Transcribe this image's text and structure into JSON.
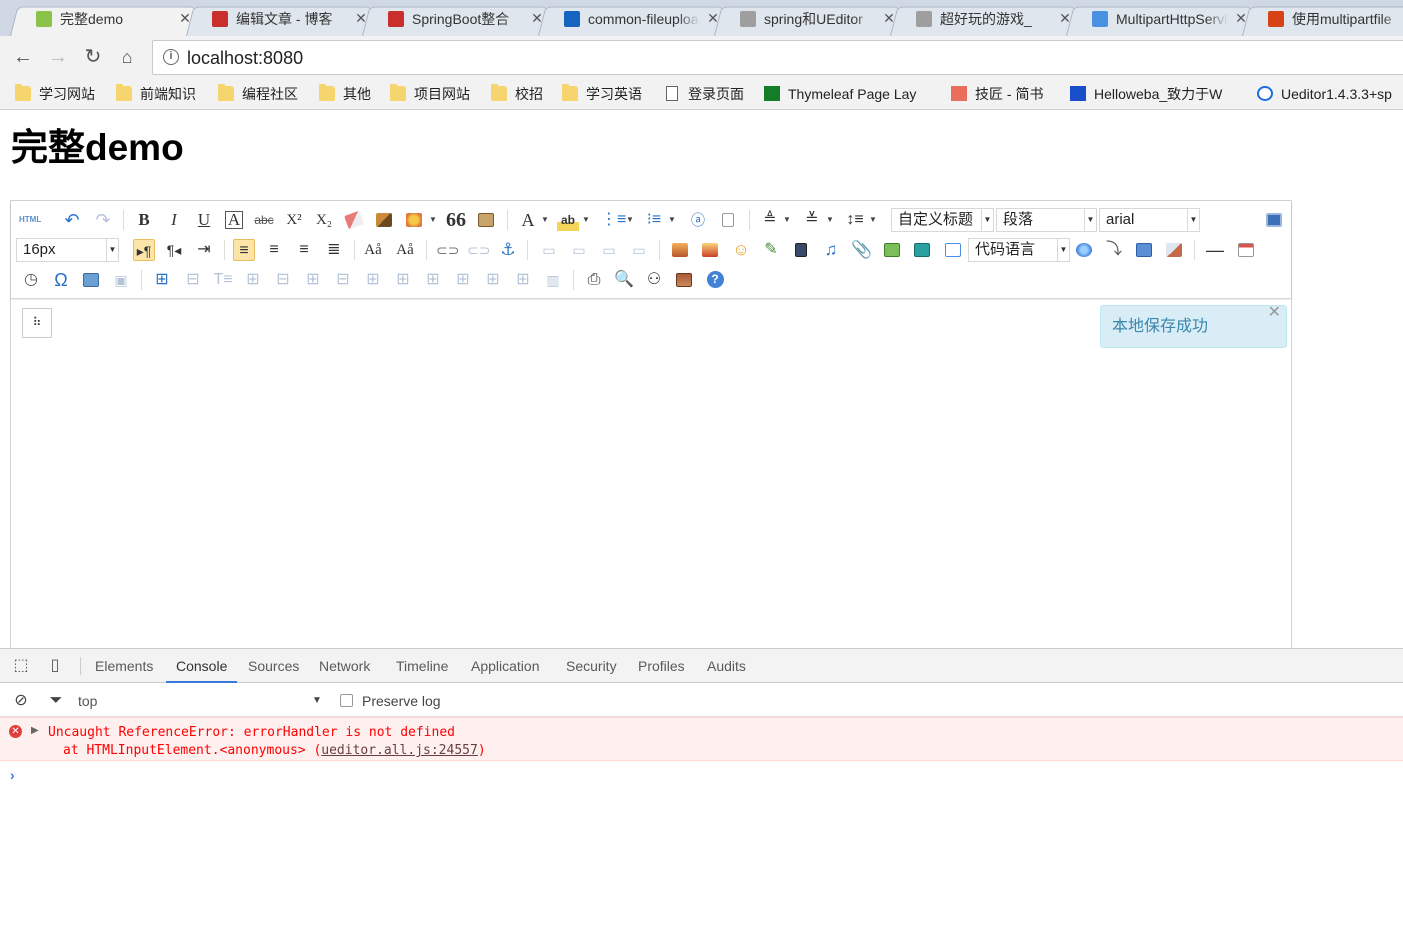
{
  "browser": {
    "tabs": [
      {
        "title": "完整demo",
        "favicon": "leaf-icon",
        "color": "#8bc34a",
        "active": true
      },
      {
        "title": "编辑文章 - 博客",
        "favicon": "csdn-icon",
        "color": "#c9302c",
        "active": false
      },
      {
        "title": "SpringBoot整合",
        "favicon": "csdn-icon",
        "color": "#c9302c",
        "active": false
      },
      {
        "title": "common-fileupload",
        "favicon": "refresh-page-icon",
        "color": "#1565c0",
        "active": false
      },
      {
        "title": "spring和UEditor",
        "favicon": "loading-icon",
        "color": "#9e9e9e",
        "active": false
      },
      {
        "title": "超好玩的游戏_",
        "favicon": "loading-icon",
        "color": "#9e9e9e",
        "active": false
      },
      {
        "title": "MultipartHttpServlet",
        "favicon": "c-icon",
        "color": "#4a90e2",
        "active": false
      },
      {
        "title": "使用multipartfile",
        "favicon": "colorful-icon",
        "color": "#d84315",
        "active": false
      }
    ],
    "tab_close": "✕",
    "url": "localhost:8080",
    "bookmarks": [
      {
        "label": "学习网站",
        "icon": "folder"
      },
      {
        "label": "前端知识",
        "icon": "folder"
      },
      {
        "label": "编程社区",
        "icon": "folder"
      },
      {
        "label": "其他",
        "icon": "folder"
      },
      {
        "label": "项目网站",
        "icon": "folder"
      },
      {
        "label": "校招",
        "icon": "folder"
      },
      {
        "label": "学习英语",
        "icon": "folder"
      },
      {
        "label": "登录页面",
        "icon": "page"
      },
      {
        "label": "Thymeleaf Page Lay",
        "icon": "green"
      },
      {
        "label": "技匠 - 简书",
        "icon": "red"
      },
      {
        "label": "Helloweba_致力于W",
        "icon": "blue"
      },
      {
        "label": "Ueditor1.4.3.3+sp",
        "icon": "circle"
      }
    ]
  },
  "page": {
    "heading": "完整demo"
  },
  "editor": {
    "fontsize_value": "16px",
    "custom_heading_value": "自定义标题",
    "paragraph_value": "段落",
    "fontfamily_value": "arial",
    "code_language_value": "代码语言",
    "html_button_label": "HTML",
    "notice_text": "本地保存成功",
    "notice_close": "✕"
  },
  "devtools": {
    "tabs": [
      "Elements",
      "Console",
      "Sources",
      "Network",
      "Timeline",
      "Application",
      "Security",
      "Profiles",
      "Audits"
    ],
    "active_tab": "Console",
    "context": "top",
    "preserve_log_label": "Preserve log",
    "preserve_log_checked": false,
    "error": {
      "message": "Uncaught ReferenceError: errorHandler is not defined",
      "trace_prefix": "at HTMLInputElement.<anonymous> (",
      "trace_link": "ueditor.all.js:24557",
      "trace_suffix": ")"
    },
    "prompt_symbol": "›"
  }
}
